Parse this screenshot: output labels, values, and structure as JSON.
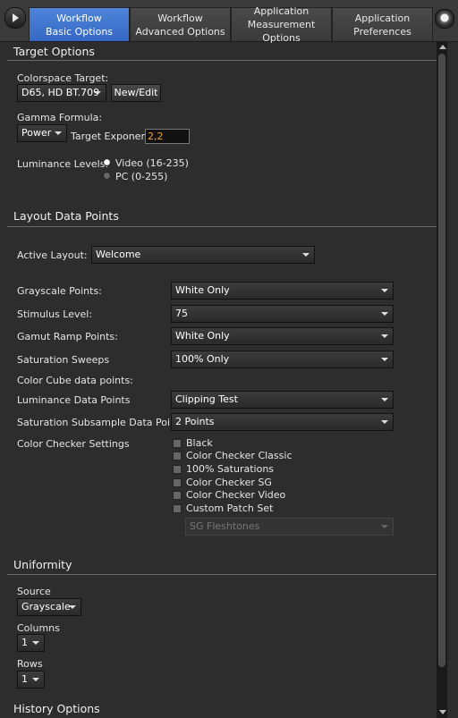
{
  "tabs": [
    {
      "line1": "Workflow",
      "line2": "Basic Options",
      "active": true
    },
    {
      "line1": "Workflow",
      "line2": "Advanced Options",
      "active": false
    },
    {
      "line1": "Application",
      "line2": "Measurement Options",
      "active": false
    },
    {
      "line1": "Application",
      "line2": "Preferences",
      "active": false
    }
  ],
  "target_options": {
    "title": "Target Options",
    "colorspace_label": "Colorspace Target:",
    "colorspace_value": "D65, HD BT.709",
    "new_edit_label": "New/Edit",
    "gamma_label": "Gamma Formula:",
    "gamma_value": "Power",
    "exponent_label": "Target Exponent",
    "exponent_value": "2,2",
    "luminance_label": "Luminance Levels:",
    "luminance_options": [
      {
        "label": "Video (16-235)",
        "checked": true
      },
      {
        "label": "PC (0-255)",
        "checked": false
      }
    ]
  },
  "layout_data_points": {
    "title": "Layout Data Points",
    "active_layout_label": "Active Layout:",
    "active_layout_value": "Welcome",
    "grayscale_label": "Grayscale Points:",
    "grayscale_value": "White Only",
    "stimulus_label": "Stimulus Level:",
    "stimulus_value": "75",
    "gamut_label": "Gamut Ramp Points:",
    "gamut_value": "White Only",
    "saturation_sweeps_label": "Saturation Sweeps",
    "saturation_sweeps_value": "100% Only",
    "color_cube_label": "Color Cube data points:",
    "luminance_dp_label": "Luminance Data Points",
    "luminance_dp_value": "Clipping Test",
    "saturation_subsample_label": "Saturation Subsample Data Points",
    "saturation_subsample_value": "2 Points",
    "color_checker_label": "Color Checker Settings",
    "color_checker_items": [
      "Black",
      "Color Checker Classic",
      "100% Saturations",
      "Color Checker SG",
      "Color Checker Video",
      "Custom Patch Set"
    ],
    "custom_patch_value": "SG Fleshtones"
  },
  "uniformity": {
    "title": "Uniformity",
    "source_label": "Source",
    "source_value": "Grayscale",
    "columns_label": "Columns",
    "columns_value": "1",
    "rows_label": "Rows",
    "rows_value": "1"
  },
  "history_options": {
    "title": "History Options"
  }
}
